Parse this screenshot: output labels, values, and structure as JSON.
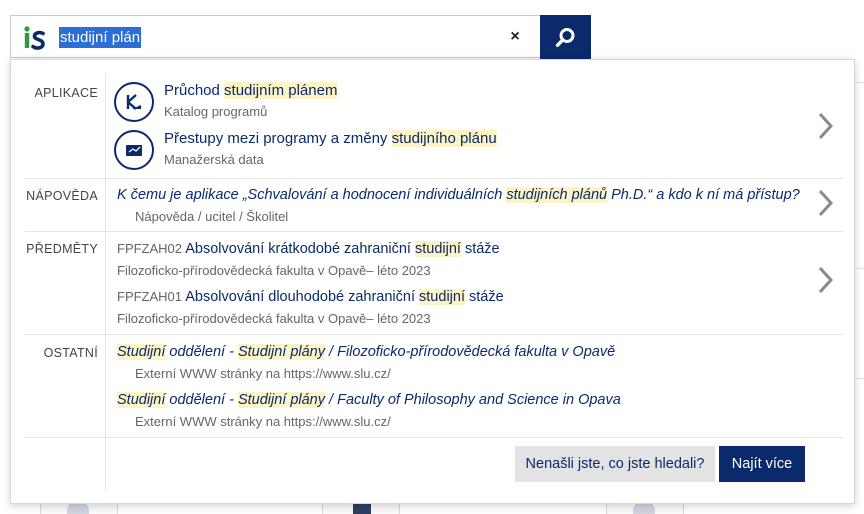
{
  "search": {
    "query": "studijní plán",
    "clear_label": "×"
  },
  "sections": {
    "aplikace": {
      "label": "APLIKACE",
      "items": [
        {
          "title_pre": "Průchod ",
          "title_hl": "studijním plánem",
          "title_post": "",
          "subtitle": "Katalog programů"
        },
        {
          "title_pre": "Přestupy mezi programy a změny ",
          "title_hl": "studijního plánu",
          "title_post": "",
          "subtitle": "Manažerská data"
        }
      ]
    },
    "napoveda": {
      "label": "NÁPOVĚDA",
      "items": [
        {
          "title_pre": "K čemu je aplikace „Schvalování a hodnocení individuálních ",
          "title_hl": "studijních plánů",
          "title_post": " Ph.D.“ a kdo k ní má přístup?",
          "subtitle": "Nápověda / ucitel / Školitel"
        }
      ]
    },
    "predmety": {
      "label": "PŘEDMĚTY",
      "items": [
        {
          "code": "FPFZAH02",
          "title_pre": "Absolvování krátkodobé zahraniční ",
          "title_hl": "studijní",
          "title_post": " stáže",
          "subtitle": "Filozoficko-přírodovědecká fakulta v Opavě– léto 2023"
        },
        {
          "code": "FPFZAH01",
          "title_pre": "Absolvování dlouhodobé zahraniční ",
          "title_hl": "studijní",
          "title_post": " stáže",
          "subtitle": "Filozoficko-přírodovědecká fakulta v Opavě– léto 2023"
        }
      ]
    },
    "ostatni": {
      "label": "OSTATNÍ",
      "items": [
        {
          "hl1": "Studijní",
          "mid1": " oddělení - ",
          "hl2": "Studijní plány",
          "post": " / Filozoficko-přírodovědecká fakulta v Opavě",
          "subtitle": "Externí WWW stránky na https://www.slu.cz/"
        },
        {
          "hl1": "Studijní",
          "mid1": " oddělení - ",
          "hl2": "Studijní plány",
          "post": " / Faculty of Philosophy and Science in Opava",
          "subtitle": "Externí WWW stránky na https://www.slu.cz/"
        }
      ]
    }
  },
  "buttons": {
    "not_found": "Nenašli jste, co jste hledali?",
    "find_more": "Najít více"
  },
  "colors": {
    "brand": "#0a2a6b",
    "highlight": "#fdf3c4",
    "logo_green": "#2e9b3e"
  },
  "icons": {
    "logo": "is-logo-icon",
    "search": "magnifier-icon",
    "app1": "katalog-programu-icon",
    "app2": "manazerska-data-icon",
    "chevron": "chevron-right-icon"
  }
}
